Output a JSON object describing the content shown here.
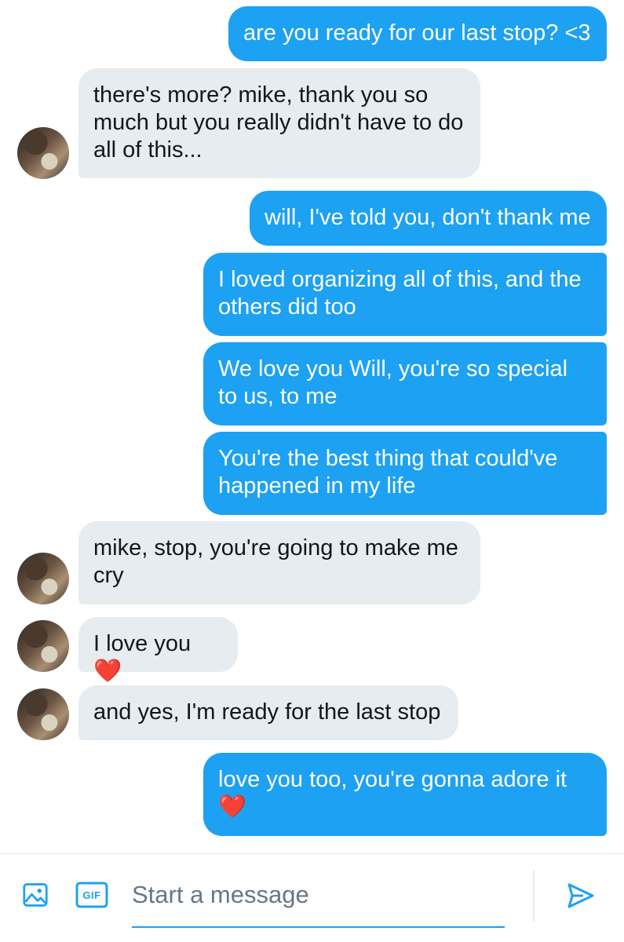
{
  "messages": [
    {
      "dir": "out",
      "text": "are you ready for our last stop? <3"
    },
    {
      "dir": "in",
      "text": "there's more? mike, thank you so much but you really didn't have to do all of this..."
    },
    {
      "dir": "out",
      "text": "will, I've told you, don't thank me"
    },
    {
      "dir": "out",
      "text": "I loved organizing all of this, and the others did too"
    },
    {
      "dir": "out",
      "text": "We love you Will, you're so special to us, to me"
    },
    {
      "dir": "out",
      "text": "You're the best thing that could've happened in my life"
    },
    {
      "dir": "in",
      "text": "mike, stop, you're going to make me cry"
    },
    {
      "dir": "in",
      "text": "I love you",
      "emoji": "❤️"
    },
    {
      "dir": "in",
      "text": "and yes, I'm ready for the last stop"
    },
    {
      "dir": "out",
      "text": "love you too, you're gonna adore it",
      "emoji": "❤️"
    }
  ],
  "composer": {
    "placeholder": "Start a message",
    "gif_label": "GIF",
    "icons": [
      "image-icon",
      "gif-icon",
      "send-icon"
    ]
  },
  "colors": {
    "outgoing_bubble": "#1da1f2",
    "incoming_bubble": "#e6ecf0",
    "accent": "#1da1f2",
    "heart": "#e0245e"
  }
}
